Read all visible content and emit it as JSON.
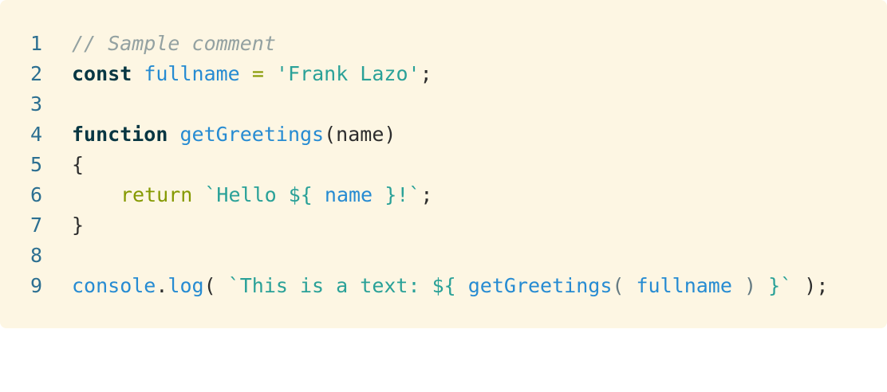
{
  "line_numbers": [
    "1",
    "2",
    "3",
    "4",
    "5",
    "6",
    "7",
    "8",
    "9"
  ],
  "code": {
    "l1": {
      "comment": "// Sample comment"
    },
    "l2": {
      "kw": "const",
      "ident": "fullname",
      "op": "=",
      "str": "'Frank Lazo'",
      "semi": ";"
    },
    "l4": {
      "kw": "function",
      "ident": "getGreetings",
      "open": "(",
      "param": "name",
      "close": ")"
    },
    "l5": {
      "brace": "{"
    },
    "l6": {
      "kw": "return",
      "str_a": "`Hello ${",
      "ident": "name",
      "str_b": "}!`",
      "semi": ";"
    },
    "l7": {
      "brace": "}"
    },
    "l9": {
      "obj": "console",
      "dot": ".",
      "method": "log",
      "open": "(",
      "str_a": "`This is a text: ${",
      "fn": "getGreetings",
      "open2": "(",
      "arg": "fullname",
      "close2": ")",
      "str_b": "}`",
      "close": ");"
    }
  }
}
